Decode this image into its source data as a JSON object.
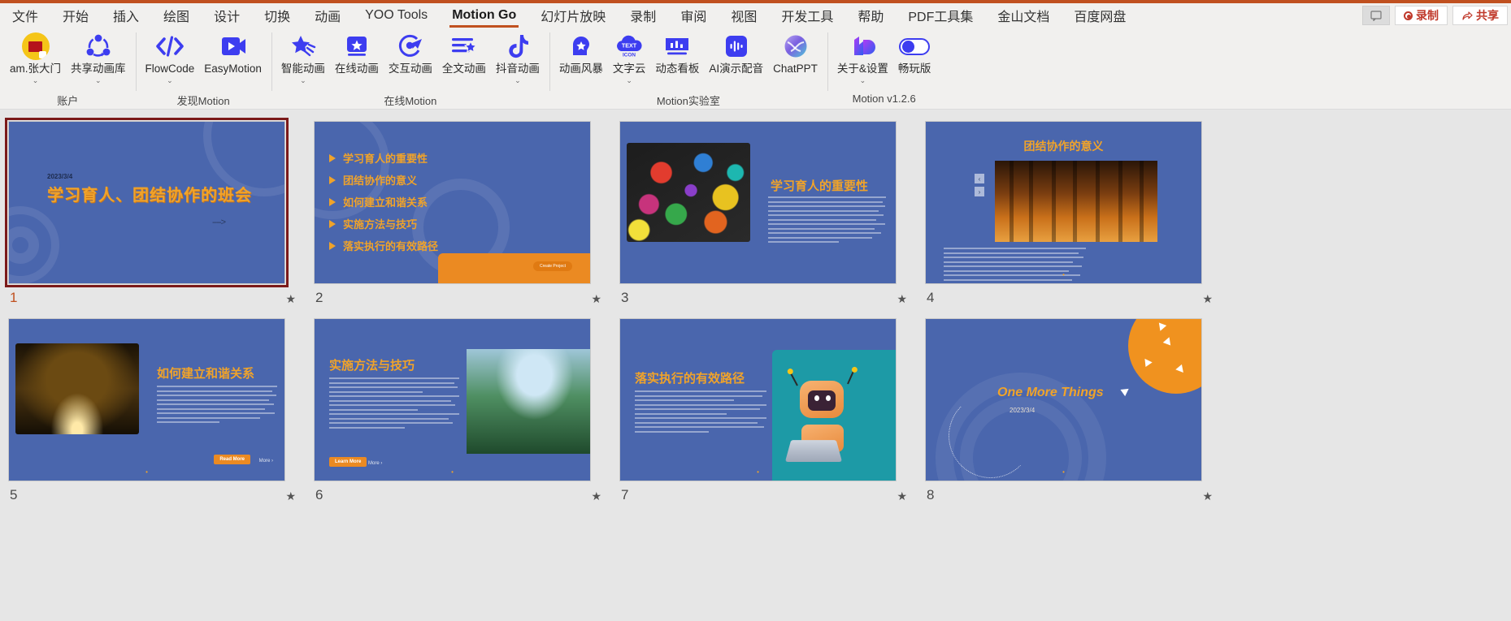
{
  "window": {
    "accent_color": "#c0501f",
    "ribbon_bg": "#f1f0ee"
  },
  "menubar": {
    "items": [
      {
        "label": "文件",
        "active": false
      },
      {
        "label": "开始",
        "active": false
      },
      {
        "label": "插入",
        "active": false
      },
      {
        "label": "绘图",
        "active": false
      },
      {
        "label": "设计",
        "active": false
      },
      {
        "label": "切换",
        "active": false
      },
      {
        "label": "动画",
        "active": false
      },
      {
        "label": "YOO Tools",
        "active": false
      },
      {
        "label": "Motion Go",
        "active": true
      },
      {
        "label": "幻灯片放映",
        "active": false
      },
      {
        "label": "录制",
        "active": false
      },
      {
        "label": "审阅",
        "active": false
      },
      {
        "label": "视图",
        "active": false
      },
      {
        "label": "开发工具",
        "active": false
      },
      {
        "label": "帮助",
        "active": false
      },
      {
        "label": "PDF工具集",
        "active": false
      },
      {
        "label": "金山文档",
        "active": false
      },
      {
        "label": "百度网盘",
        "active": false
      }
    ],
    "comment_button": "",
    "record_button": "录制",
    "share_button": "共享"
  },
  "ribbon": {
    "groups": [
      {
        "label": "账户",
        "items": [
          {
            "label": "am.张大门",
            "icon": "user-avatar-icon",
            "caret": true
          },
          {
            "label": "共享动画库",
            "icon": "share-animation-library-icon",
            "caret": true
          }
        ]
      },
      {
        "label": "发现Motion",
        "items": [
          {
            "label": "FlowCode",
            "icon": "code-brackets-icon",
            "caret": true
          },
          {
            "label": "EasyMotion",
            "icon": "play-video-icon",
            "caret": false
          }
        ]
      },
      {
        "label": "在线Motion",
        "items": [
          {
            "label": "智能动画",
            "icon": "shooting-star-icon",
            "caret": true
          },
          {
            "label": "在线动画",
            "icon": "star-box-icon",
            "caret": false
          },
          {
            "label": "交互动画",
            "icon": "cursor-target-icon",
            "caret": false
          },
          {
            "label": "全文动画",
            "icon": "list-star-icon",
            "caret": false
          },
          {
            "label": "抖音动画",
            "icon": "tiktok-note-icon",
            "caret": true
          }
        ]
      },
      {
        "label": "Motion实验室",
        "items": [
          {
            "label": "动画风暴",
            "icon": "head-star-icon",
            "caret": false
          },
          {
            "label": "文字云",
            "icon": "text-cloud-icon",
            "caret": true
          },
          {
            "label": "动态看板",
            "icon": "bar-chart-monitor-icon",
            "caret": false
          },
          {
            "label": "AI演示配音",
            "icon": "audio-waveform-icon",
            "caret": false
          },
          {
            "label": "ChatPPT",
            "icon": "chatppt-orb-icon",
            "caret": false
          }
        ]
      },
      {
        "label": "Motion v1.2.6",
        "items": [
          {
            "label": "关于&设置",
            "icon": "motion-logo-icon",
            "caret": true
          },
          {
            "label": "畅玩版",
            "icon": "toggle-switch-icon",
            "caret": false
          }
        ]
      }
    ]
  },
  "slides": [
    {
      "number": "1",
      "selected": true,
      "has_animation": true,
      "layout": "title",
      "date": "2023/3/4",
      "title": "学习育人、团结协作的班会",
      "arrow": "---->"
    },
    {
      "number": "2",
      "selected": false,
      "has_animation": true,
      "layout": "agenda",
      "items": [
        "学习育人的重要性",
        "团结协作的意义",
        "如何建立和谐关系",
        "实施方法与技巧",
        "落实执行的有效路径"
      ],
      "button": "Create Project"
    },
    {
      "number": "3",
      "selected": false,
      "has_animation": true,
      "layout": "image-left",
      "title": "学习育人的重要性",
      "body_lines": 11
    },
    {
      "number": "4",
      "selected": false,
      "has_animation": true,
      "layout": "centered-title-image",
      "title": "团结协作的意义",
      "nav_prev": "‹",
      "nav_next": "›",
      "body_lines": 9
    },
    {
      "number": "5",
      "selected": false,
      "has_animation": true,
      "layout": "image-left",
      "title": "如何建立和谐关系",
      "body_lines": 9,
      "button": "Read More",
      "more_label": "More ›"
    },
    {
      "number": "6",
      "selected": false,
      "has_animation": true,
      "layout": "image-right",
      "title": "实施方法与技巧",
      "body_lines": 12,
      "button": "Learn More",
      "more_label": "More ›"
    },
    {
      "number": "7",
      "selected": false,
      "has_animation": true,
      "layout": "image-right-robot",
      "title": "落实执行的有效路径",
      "body_lines": 10
    },
    {
      "number": "8",
      "selected": false,
      "has_animation": true,
      "layout": "closing",
      "title": "One More Things",
      "date": "2023/3/4"
    }
  ],
  "theme": {
    "slide_bg": "#4a66ad",
    "accent_orange": "#f0a32a",
    "button_orange": "#eb8a22",
    "selection_border": "#7b1a1a"
  }
}
